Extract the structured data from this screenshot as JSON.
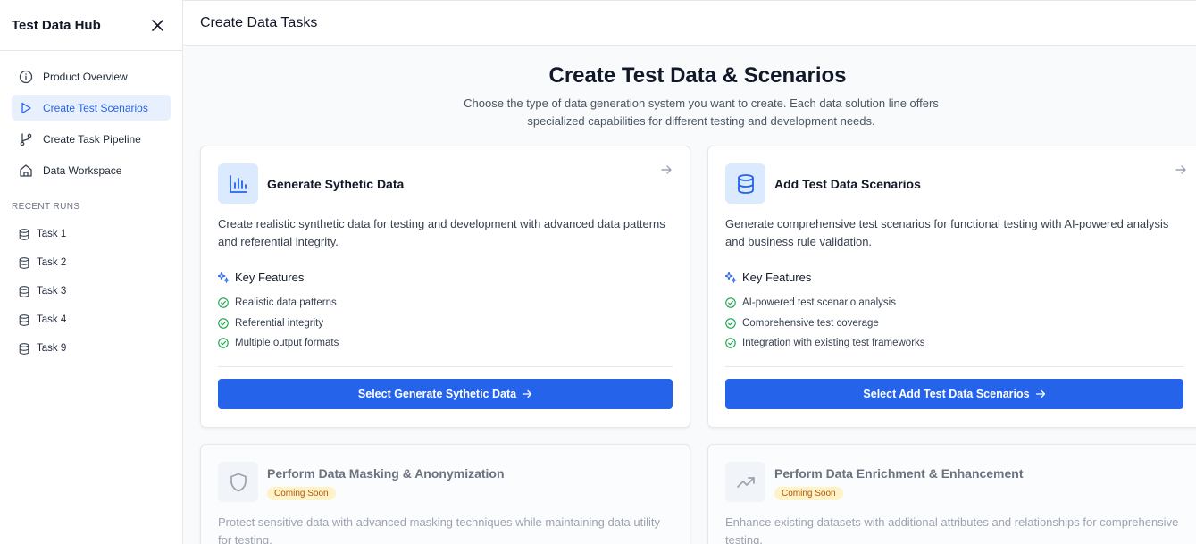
{
  "sidebar": {
    "title": "Test Data Hub",
    "nav": [
      {
        "label": "Product Overview",
        "icon": "info-icon"
      },
      {
        "label": "Create Test Scenarios",
        "icon": "play-icon",
        "active": true
      },
      {
        "label": "Create Task Pipeline",
        "icon": "branch-icon"
      },
      {
        "label": "Data Workspace",
        "icon": "home-icon"
      }
    ],
    "recent_title": "RECENT RUNS",
    "recent_runs": [
      "Task 1",
      "Task 2",
      "Task 3",
      "Task 4",
      "Task 9"
    ]
  },
  "header": {
    "title": "Create Data Tasks"
  },
  "hero": {
    "title": "Create Test Data & Scenarios",
    "subtitle": "Choose the type of data generation system you want to create. Each data solution line offers specialized capabilities for different testing and development needs."
  },
  "cards": [
    {
      "title": "Generate Sythetic Data",
      "icon": "bar-chart-icon",
      "description": "Create realistic synthetic data for testing and development with advanced data patterns and referential integrity.",
      "features_title": "Key Features",
      "features": [
        "Realistic data patterns",
        "Referential integrity",
        "Multiple output formats"
      ],
      "button": "Select Generate Sythetic Data"
    },
    {
      "title": "Add Test Data Scenarios",
      "icon": "database-icon",
      "description": "Generate comprehensive test scenarios for functional testing with AI-powered analysis and business rule validation.",
      "features_title": "Key Features",
      "features": [
        "AI-powered test scenario analysis",
        "Comprehensive test coverage",
        "Integration with existing test frameworks"
      ],
      "button": "Select Add Test Data Scenarios"
    },
    {
      "title": "Perform Data Masking & Anonymization",
      "icon": "shield-icon",
      "badge": "Coming Soon",
      "description": "Protect sensitive data with advanced masking techniques while maintaining data utility for testing."
    },
    {
      "title": "Perform Data Enrichment & Enhancement",
      "icon": "trending-up-icon",
      "badge": "Coming Soon",
      "description": "Enhance existing datasets with additional attributes and relationships for comprehensive testing."
    }
  ],
  "colors": {
    "primary": "#2563eb",
    "success": "#16a34a",
    "badge_bg": "#fef3c7",
    "badge_text": "#b45309"
  }
}
